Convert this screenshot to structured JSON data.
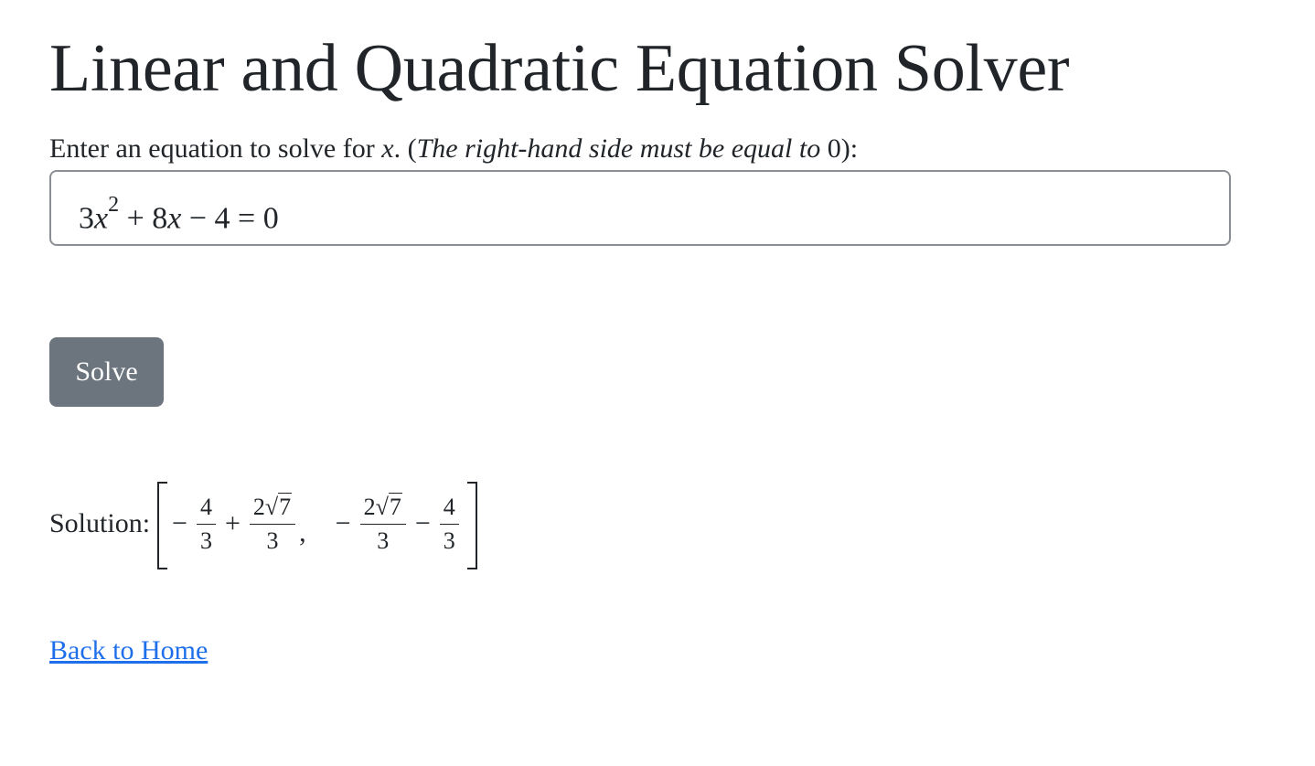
{
  "header": {
    "title": "Linear and Quadratic Equation Solver"
  },
  "prompt": {
    "before": "Enter an equation to solve for ",
    "variable": "x",
    "middle": ". (",
    "italic": "The right-hand side must be equal to",
    "zero": " 0",
    "after": "):"
  },
  "equation_input": {
    "coef_a": "3",
    "var": "x",
    "exponent": "2",
    "rest_a": " + 8",
    "var_b": "x",
    "rest_b": " − 4 = 0"
  },
  "solve_button": {
    "label": "Solve"
  },
  "solution": {
    "label": "Solution:",
    "root1": {
      "sign": "−",
      "frac1_num": "4",
      "frac1_den": "3",
      "op": "+",
      "frac2_coef": "2",
      "frac2_sqrt_sym": "√",
      "frac2_radicand": "7",
      "frac2_den": "3"
    },
    "separator": ",",
    "root2": {
      "sign": "−",
      "frac1_coef": "2",
      "frac1_sqrt_sym": "√",
      "frac1_radicand": "7",
      "frac1_den": "3",
      "op": "−",
      "frac2_num": "4",
      "frac2_den": "3"
    }
  },
  "footer": {
    "home_link": "Back to Home"
  },
  "colors": {
    "text": "#212529",
    "button_bg": "#6c757d",
    "link": "#1f6feb",
    "input_border": "#8b8f94"
  }
}
